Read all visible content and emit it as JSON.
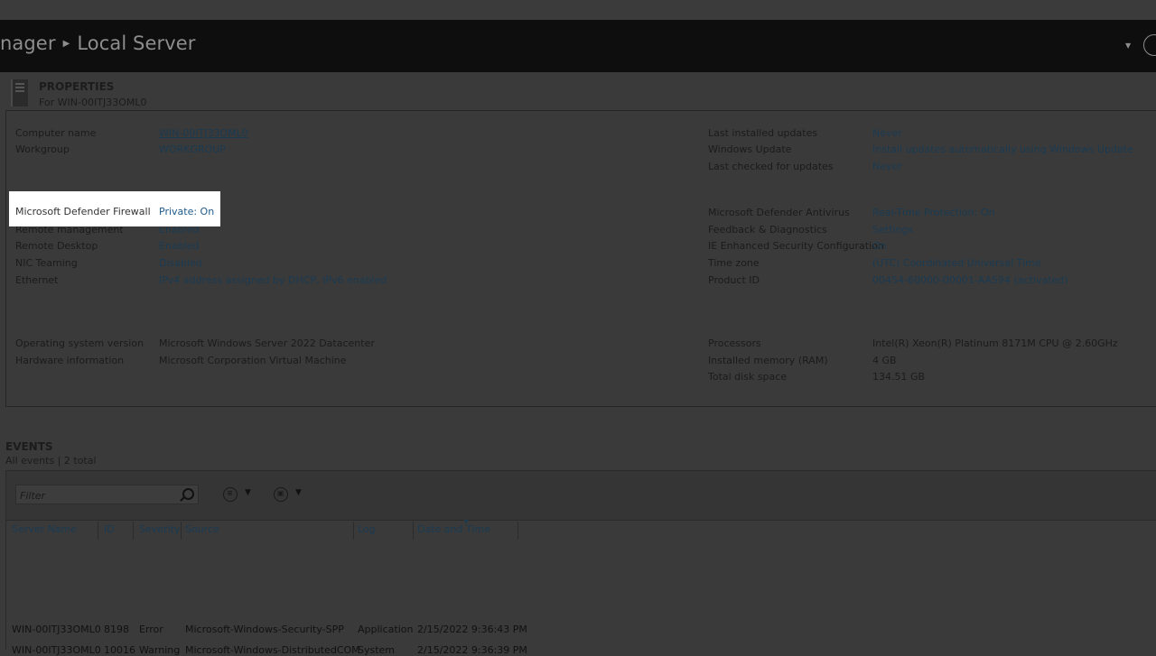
{
  "header": {
    "breadcrumb_parent": "nager",
    "breadcrumb_current": "Local Server"
  },
  "properties": {
    "title": "PROPERTIES",
    "subtitle": "For WIN-00ITJ33OML0",
    "left_top": [
      {
        "label": "Computer name",
        "value": "WIN-00ITJ33OML0"
      },
      {
        "label": "Workgroup",
        "value": "WORKGROUP"
      }
    ],
    "left_mid": [
      {
        "label": "Microsoft Defender Firewall",
        "value": "Private: On"
      },
      {
        "label": "Remote management",
        "value": "Enabled"
      },
      {
        "label": "Remote Desktop",
        "value": "Enabled"
      },
      {
        "label": "NIC Teaming",
        "value": "Disabled"
      },
      {
        "label": "Ethernet",
        "value": "IPv4 address assigned by DHCP, IPv6 enabled"
      }
    ],
    "left_bottom": [
      {
        "label": "Operating system version",
        "value": "Microsoft Windows Server 2022 Datacenter"
      },
      {
        "label": "Hardware information",
        "value": "Microsoft Corporation Virtual Machine"
      }
    ],
    "right_top": [
      {
        "label": "Last installed updates",
        "value": "Never"
      },
      {
        "label": "Windows Update",
        "value": "Install updates automatically using Windows Update"
      },
      {
        "label": "Last checked for updates",
        "value": "Never"
      }
    ],
    "right_mid": [
      {
        "label": "Microsoft Defender Antivirus",
        "value": "Real-Time Protection: On"
      },
      {
        "label": "Feedback & Diagnostics",
        "value": "Settings"
      },
      {
        "label": "IE Enhanced Security Configuration",
        "value": "On"
      },
      {
        "label": "Time zone",
        "value": "(UTC) Coordinated Universal Time"
      },
      {
        "label": "Product ID",
        "value": "00454-60000-00001-AA594 (activated)"
      }
    ],
    "right_bottom": [
      {
        "label": "Processors",
        "value": "Intel(R) Xeon(R) Platinum 8171M CPU @ 2.60GHz"
      },
      {
        "label": "Installed memory (RAM)",
        "value": "4 GB"
      },
      {
        "label": "Total disk space",
        "value": "134.51 GB"
      }
    ]
  },
  "events": {
    "title": "EVENTS",
    "subtitle": "All events | 2 total",
    "filter_placeholder": "Filter",
    "columns": [
      "Server Name",
      "ID",
      "Severity",
      "Source",
      "Log",
      "Date and Time"
    ],
    "rows": [
      [
        "WIN-00ITJ33OML0",
        "8198",
        "Error",
        "Microsoft-Windows-Security-SPP",
        "Application",
        "2/15/2022 9:36:43 PM"
      ],
      [
        "WIN-00ITJ33OML0",
        "10016",
        "Warning",
        "Microsoft-Windows-DistributedCOM",
        "System",
        "2/15/2022 9:36:39 PM"
      ]
    ]
  },
  "colors": {
    "titlebar": "#0e0e0e",
    "background": "#3a3a3a",
    "link_dimmed": "#1a3a52",
    "link_highlight": "#1e5a8c",
    "highlight_bg": "#ffffff"
  }
}
